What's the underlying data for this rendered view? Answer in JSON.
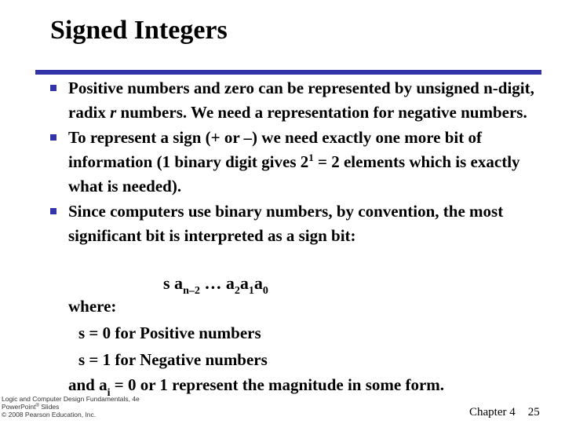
{
  "slide": {
    "title": "Signed Integers",
    "accent_color": "#3333aa",
    "bullets": [
      {
        "text": "Positive numbers and zero can be represented by unsigned n-digit, radix ",
        "italic": "r",
        "text_after": " numbers.   We need a representation for negative numbers."
      },
      {
        "text_before": "To represent a sign (+ or –) we need exactly one more bit of information (1 binary digit gives 2",
        "superscript": "1",
        "text_after": " = 2 elements which is exactly what is needed)."
      },
      {
        "text": "Since computers use binary numbers, by convention, the most significant bit is interpreted as a sign bit:"
      }
    ],
    "formula": {
      "s": "s a",
      "sub1": "n–2",
      "mid": " … a",
      "sub2": "2",
      "a1": "a",
      "sub3": "1",
      "a0": "a",
      "sub4": "0"
    },
    "where_label": "where:",
    "s0_line": "s = 0 for Positive numbers",
    "s1_line": "s = 1 for Negative numbers",
    "and_line": {
      "before": "and a",
      "sub": "i",
      "after": " = 0 or 1 represent the magnitude in some form."
    }
  },
  "footer": {
    "book_line": "Logic and Computer Design Fundamentals, 4e",
    "slides_line_before": "PowerPoint",
    "slides_line_sup": "®",
    "slides_line_after": " Slides",
    "copyright_line": "© 2008 Pearson Education, Inc.",
    "chapter": "Chapter 4",
    "page_number": "25"
  }
}
